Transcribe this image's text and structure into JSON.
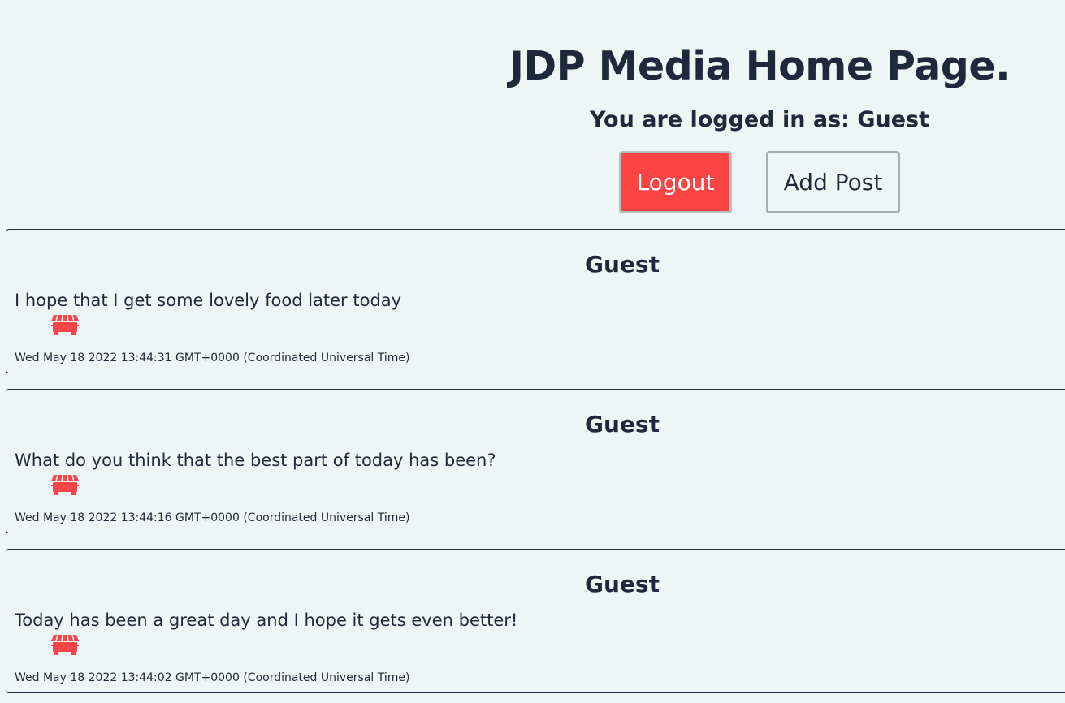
{
  "header": {
    "title": "JDP Media Home Page.",
    "login_status": "You are logged in as: Guest",
    "logout_label": "Logout",
    "add_post_label": "Add Post"
  },
  "colors": {
    "accent_red": "#fb4444",
    "background": "#edf5f5",
    "text": "#1e2a3b"
  },
  "posts": [
    {
      "author": "Guest",
      "body": "I hope that I get some lovely food later today",
      "icon": "dumpster-icon",
      "date": "Wed May 18 2022 13:44:31 GMT+0000 (Coordinated Universal Time)"
    },
    {
      "author": "Guest",
      "body": "What do you think that the best part of today has been?",
      "icon": "dumpster-icon",
      "date": "Wed May 18 2022 13:44:16 GMT+0000 (Coordinated Universal Time)"
    },
    {
      "author": "Guest",
      "body": "Today has been a great day and I hope it gets even better!",
      "icon": "dumpster-icon",
      "date": "Wed May 18 2022 13:44:02 GMT+0000 (Coordinated Universal Time)"
    }
  ]
}
